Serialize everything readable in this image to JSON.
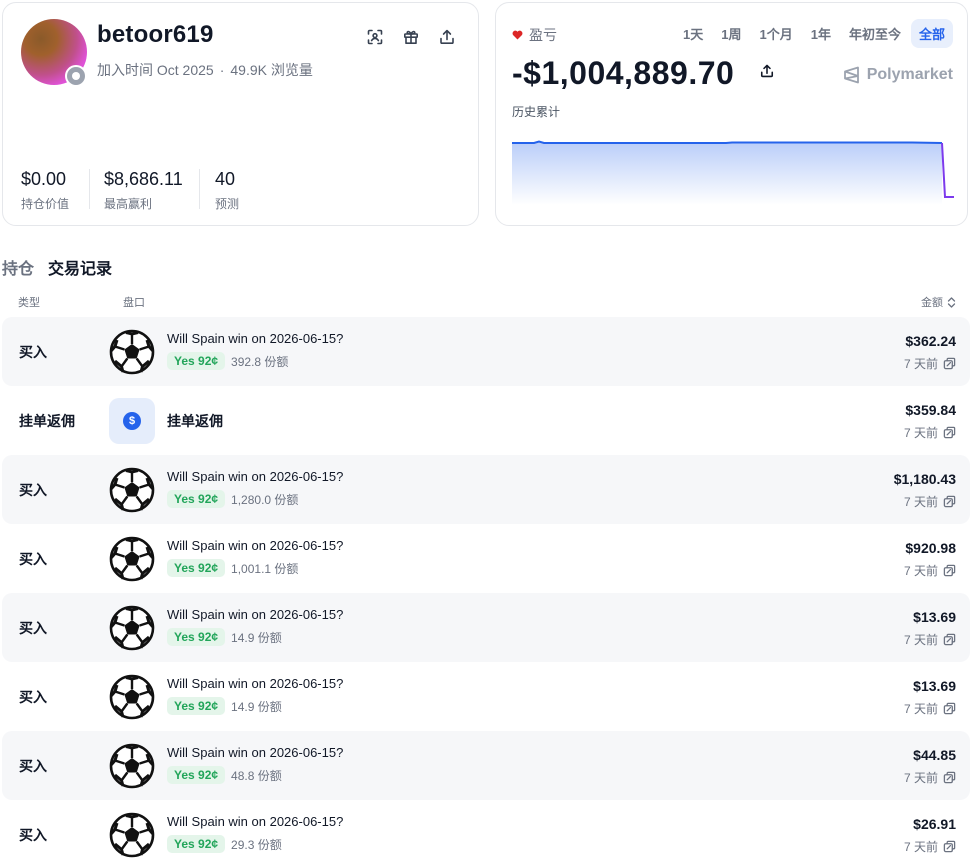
{
  "profile": {
    "username": "betoor619",
    "joined": "加入时间 Oct 2025",
    "separator": "·",
    "views": "49.9K 浏览量",
    "stats": [
      {
        "value": "$0.00",
        "label": "持仓价值"
      },
      {
        "value": "$8,686.11",
        "label": "最高赢利"
      },
      {
        "value": "40",
        "label": "预测"
      }
    ],
    "icons": [
      "scan-icon",
      "gift-icon",
      "share-icon"
    ]
  },
  "pnl": {
    "label": "盈亏",
    "value": "-$1,004,889.70",
    "ranges": [
      "1天",
      "1周",
      "1个月",
      "1年",
      "年初至今",
      "全部"
    ],
    "active_range": "全部",
    "brand": "Polymarket",
    "history_label": "历史累计",
    "colors": {
      "line": "#2563eb",
      "drop": "#7c3aed",
      "heart": "#dc2626"
    }
  },
  "tabs": [
    {
      "label": "持仓",
      "active": false
    },
    {
      "label": "交易记录",
      "active": true
    }
  ],
  "table": {
    "col_type": "类型",
    "col_market": "盘口",
    "col_amount": "金额",
    "rows": [
      {
        "type": "买入",
        "kind": "market",
        "title": "Will Spain win on 2026-06-15?",
        "outcome": "Yes 92¢",
        "shares": "392.8 份额",
        "amount": "$362.24",
        "time": "7 天前"
      },
      {
        "type": "挂单返佣",
        "kind": "rebate",
        "title": "挂单返佣",
        "amount": "$359.84",
        "time": "7 天前"
      },
      {
        "type": "买入",
        "kind": "market",
        "title": "Will Spain win on 2026-06-15?",
        "outcome": "Yes 92¢",
        "shares": "1,280.0 份额",
        "amount": "$1,180.43",
        "time": "7 天前"
      },
      {
        "type": "买入",
        "kind": "market",
        "title": "Will Spain win on 2026-06-15?",
        "outcome": "Yes 92¢",
        "shares": "1,001.1 份额",
        "amount": "$920.98",
        "time": "7 天前"
      },
      {
        "type": "买入",
        "kind": "market",
        "title": "Will Spain win on 2026-06-15?",
        "outcome": "Yes 92¢",
        "shares": "14.9 份额",
        "amount": "$13.69",
        "time": "7 天前"
      },
      {
        "type": "买入",
        "kind": "market",
        "title": "Will Spain win on 2026-06-15?",
        "outcome": "Yes 92¢",
        "shares": "14.9 份额",
        "amount": "$13.69",
        "time": "7 天前"
      },
      {
        "type": "买入",
        "kind": "market",
        "title": "Will Spain win on 2026-06-15?",
        "outcome": "Yes 92¢",
        "shares": "48.8 份额",
        "amount": "$44.85",
        "time": "7 天前"
      },
      {
        "type": "买入",
        "kind": "market",
        "title": "Will Spain win on 2026-06-15?",
        "outcome": "Yes 92¢",
        "shares": "29.3 份额",
        "amount": "$26.91",
        "time": "7 天前"
      }
    ]
  }
}
